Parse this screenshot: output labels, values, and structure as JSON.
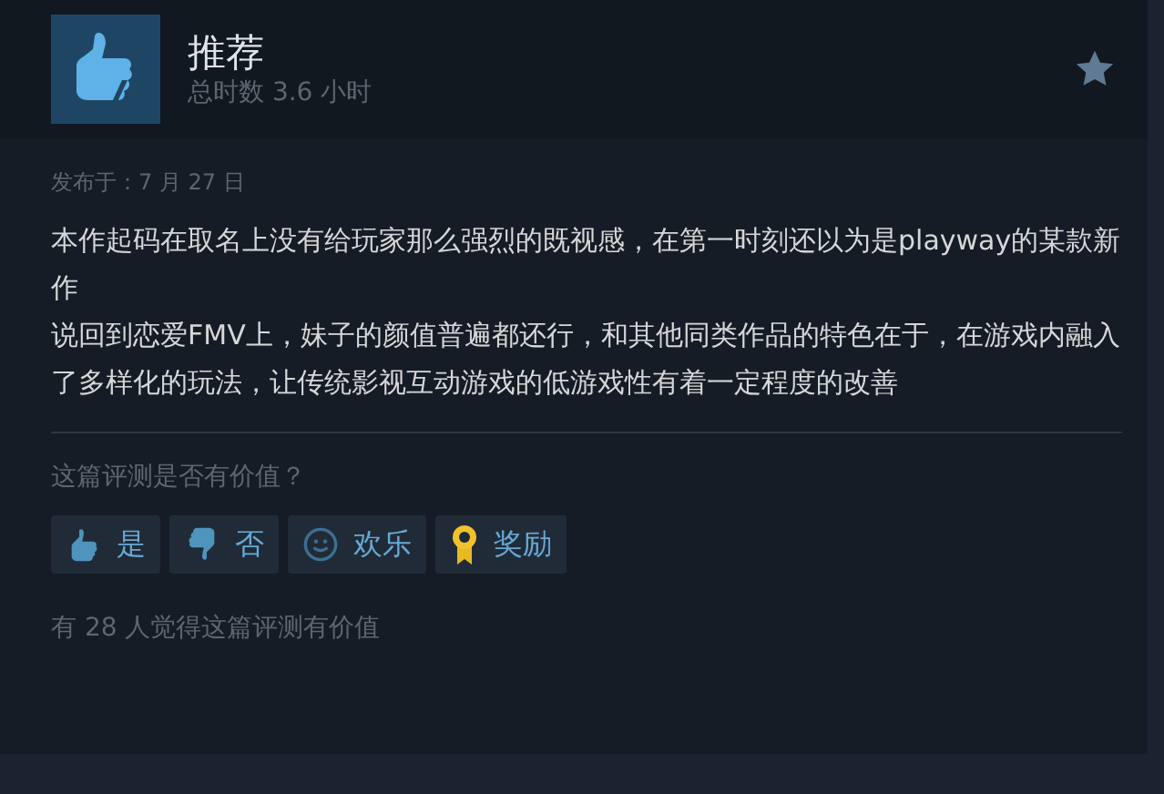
{
  "review": {
    "verdict": "推荐",
    "hours": "总时数 3.6 小时",
    "posted": "发布于：7 月 27 日",
    "paragraphs": [
      "本作起码在取名上没有给玩家那么强烈的既视感，在第一时刻还以为是playway的某款新作",
      "说回到恋爱FMV上，妹子的颜值普遍都还行，和其他同类作品的特色在于，在游戏内融入了多样化的玩法，让传统影视互动游戏的低游戏性有着一定程度的改善"
    ]
  },
  "feedback": {
    "question": "这篇评测是否有价值？",
    "buttons": [
      {
        "kind": "yes",
        "label": "是"
      },
      {
        "kind": "no",
        "label": "否"
      },
      {
        "kind": "funny",
        "label": "欢乐"
      },
      {
        "kind": "award",
        "label": "奖励"
      }
    ],
    "summary": "有 28 人觉得这篇评测有价值"
  }
}
